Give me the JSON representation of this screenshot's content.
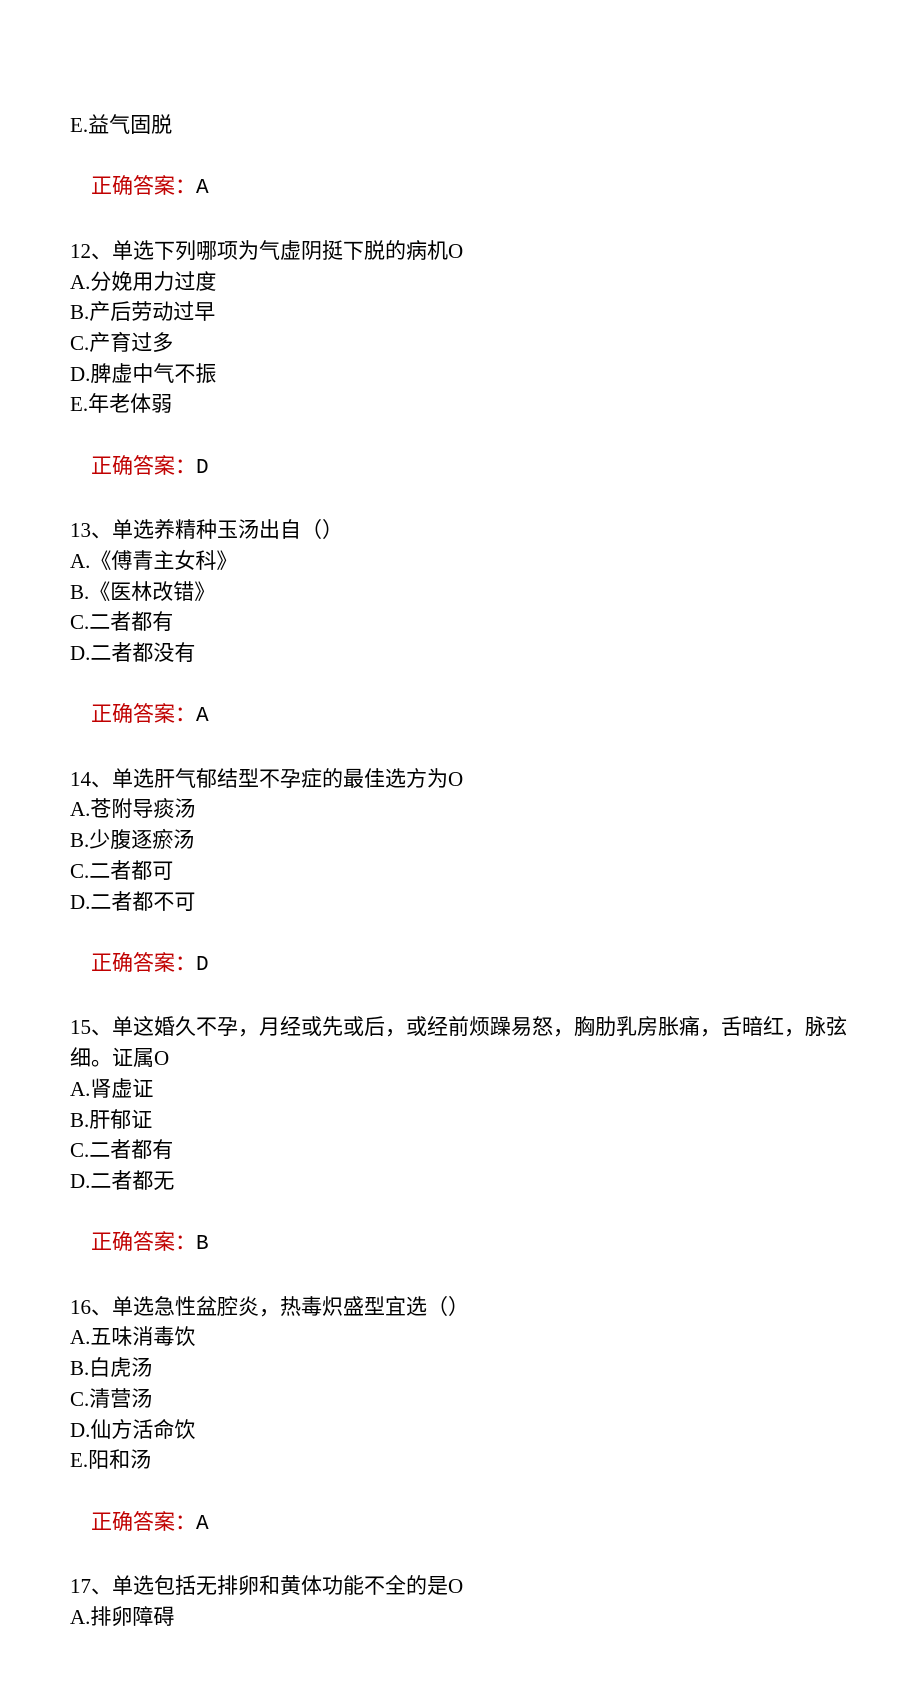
{
  "answer_label": "正确答案：",
  "q11": {
    "optE": "E.益气固脱",
    "answer": "A"
  },
  "q12": {
    "stem": "12、单选下列哪项为气虚阴挺下脱的病机O",
    "optA": "A.分娩用力过度",
    "optB": "B.产后劳动过早",
    "optC": "C.产育过多",
    "optD": "D.脾虚中气不振",
    "optE": "E.年老体弱",
    "answer": "D"
  },
  "q13": {
    "stem": "13、单选养精种玉汤出自（）",
    "optA": "A.《傅青主女科》",
    "optB": "B.《医林改错》",
    "optC": "C.二者都有",
    "optD": "D.二者都没有",
    "answer": "A"
  },
  "q14": {
    "stem": "14、单选肝气郁结型不孕症的最佳选方为O",
    "optA": "A.苍附导痰汤",
    "optB": "B.少腹逐瘀汤",
    "optC": "C.二者都可",
    "optD": "D.二者都不可",
    "answer": "D"
  },
  "q15": {
    "stem": "15、单这婚久不孕，月经或先或后，或经前烦躁易怒，胸肋乳房胀痛，舌暗红，脉弦细。证属O",
    "optA": "A.肾虚证",
    "optB": "B.肝郁证",
    "optC": "C.二者都有",
    "optD": "D.二者都无",
    "answer": "B"
  },
  "q16": {
    "stem": "16、单选急性盆腔炎，热毒炽盛型宜选（）",
    "optA": "A.五味消毒饮",
    "optB": "B.白虎汤",
    "optC": "C.清营汤",
    "optD": "D.仙方活命饮",
    "optE": "E.阳和汤",
    "answer": "A"
  },
  "q17": {
    "stem": "17、单选包括无排卵和黄体功能不全的是O",
    "optA": "A.排卵障碍"
  }
}
